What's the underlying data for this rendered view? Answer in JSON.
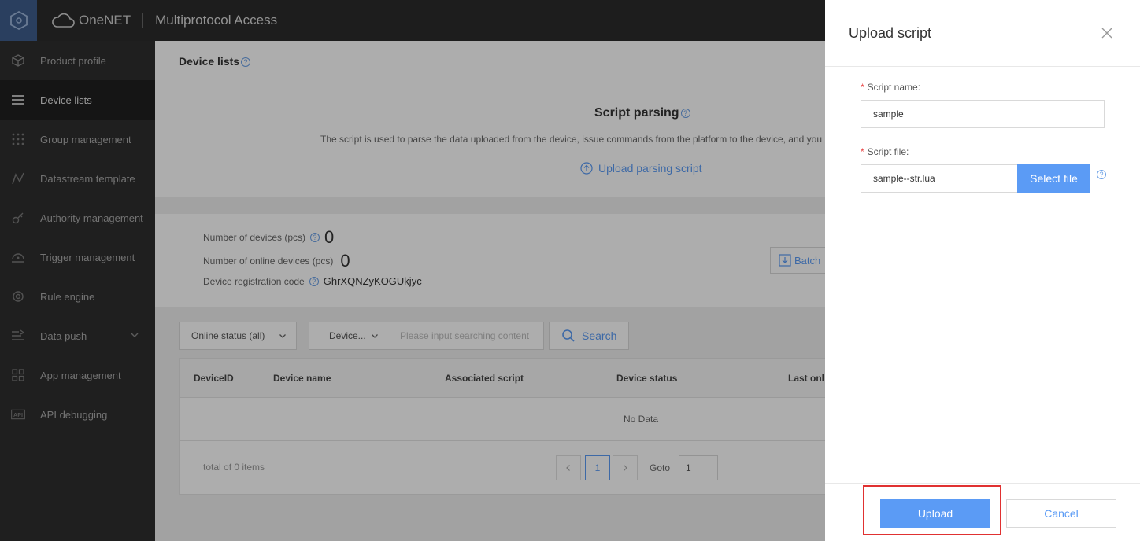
{
  "topbar": {
    "brand": "OneNET",
    "product": "Multiprotocol Access"
  },
  "sidebar": {
    "items": [
      {
        "label": "Product profile",
        "icon": "cube-icon"
      },
      {
        "label": "Device lists",
        "icon": "list-icon"
      },
      {
        "label": "Group management",
        "icon": "grid-dots-icon"
      },
      {
        "label": "Datastream template",
        "icon": "chart-icon"
      },
      {
        "label": "Authority management",
        "icon": "key-icon"
      },
      {
        "label": "Trigger management",
        "icon": "trigger-icon"
      },
      {
        "label": "Rule engine",
        "icon": "rule-icon"
      },
      {
        "label": "Data push",
        "icon": "push-icon"
      },
      {
        "label": "App management",
        "icon": "apps-icon"
      },
      {
        "label": "API debugging",
        "icon": "api-icon"
      }
    ]
  },
  "main": {
    "breadcrumb": "Device lists",
    "script_title": "Script parsing",
    "script_desc": "The script is used to parse the data uploaded from the device, issue commands from the platform to the device, and you",
    "upload_link": "Upload parsing script",
    "stats": {
      "devices_label": "Number of devices (pcs)",
      "devices_value": "0",
      "online_label": "Number of online devices (pcs)",
      "online_value": "0",
      "reg_label": "Device registration code",
      "reg_value": "GhrXQNZyKOGUkjyc"
    },
    "batch_button": "Batch",
    "filter": {
      "status": "Online status (all)",
      "field": "Device...",
      "search_placeholder": "Please input searching content",
      "search_button": "Search"
    },
    "table": {
      "columns": [
        "DeviceID",
        "Device name",
        "Associated script",
        "Device status",
        "Last onl"
      ],
      "empty": "No Data"
    },
    "pagination": {
      "total": "total of 0 items",
      "page": "1",
      "goto_label": "Goto",
      "goto_value": "1"
    }
  },
  "drawer": {
    "title": "Upload script",
    "script_name_label": "Script name:",
    "script_name_value": "sample",
    "script_file_label": "Script file:",
    "script_file_value": "sample--str.lua",
    "select_file": "Select file",
    "upload": "Upload",
    "cancel": "Cancel"
  },
  "colors": {
    "accent": "#5b9bf5",
    "highlight": "#e03131",
    "sidebar": "#2e2e2e"
  }
}
